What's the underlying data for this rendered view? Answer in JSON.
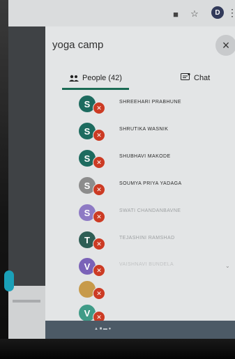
{
  "browser": {
    "profile_initial": "D",
    "bookmark_icon": "star-icon",
    "menu_icon": "more-vertical-icon"
  },
  "panel": {
    "title": "yoga camp",
    "close_label": "×",
    "tabs": [
      {
        "label": "People (42)",
        "icon": "people-icon",
        "active": true
      },
      {
        "label": "Chat",
        "icon": "chat-icon",
        "active": false
      }
    ]
  },
  "people": [
    {
      "initial": "S",
      "name": "SHREEHARI PRABHUNE",
      "avatar_color": "#1d6b5f",
      "muted": true
    },
    {
      "initial": "S",
      "name": "SHRUTIKA WASNIK",
      "avatar_color": "#1d6b5f",
      "muted": true
    },
    {
      "initial": "S",
      "name": "SHUBHAVI MAKODE",
      "avatar_color": "#1d6b5f",
      "muted": true
    },
    {
      "initial": "S",
      "name": "SOUMYA PRIYA YADAGA",
      "avatar_color": "#8c8c8c",
      "muted": true
    },
    {
      "initial": "S",
      "name": "SWATI CHANDANBAVNE",
      "avatar_color": "#8e7ac4",
      "muted": true
    },
    {
      "initial": "T",
      "name": "TEJASHINI RAMSHAD",
      "avatar_color": "#2e5e55",
      "muted": true
    },
    {
      "initial": "V",
      "name": "VAISHNAVI BUNDELA",
      "avatar_color": "#7a62b8",
      "muted": true
    },
    {
      "initial": "",
      "name": "",
      "avatar_color": "#c79a4a",
      "muted": true
    },
    {
      "initial": "V",
      "name": "",
      "avatar_color": "#3f9b87",
      "muted": true
    }
  ],
  "colors": {
    "accent": "#1b6b54",
    "muted_mic": "#cc3b24"
  }
}
